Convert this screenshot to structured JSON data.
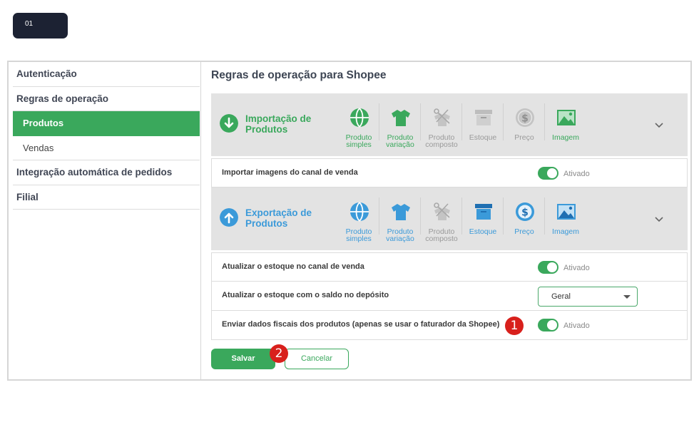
{
  "step_badge": "01",
  "sidebar": {
    "items": [
      {
        "label": "Autenticação"
      },
      {
        "label": "Regras de operação"
      },
      {
        "label": "Produtos"
      },
      {
        "label": "Vendas"
      },
      {
        "label": "Integração automática de pedidos"
      },
      {
        "label": "Filial"
      }
    ],
    "active": "Produtos"
  },
  "main": {
    "title": "Regras de operação para Shopee",
    "import_section": {
      "title": "Importação de Produtos",
      "types": [
        {
          "label": "Produto simples",
          "icon": "ball-icon",
          "enabled": true
        },
        {
          "label": "Produto variação",
          "icon": "shirt-icon",
          "enabled": true
        },
        {
          "label": "Produto composto",
          "icon": "scissors-shirt-icon",
          "enabled": false
        },
        {
          "label": "Estoque",
          "icon": "box-icon",
          "enabled": false
        },
        {
          "label": "Preço",
          "icon": "dollar-icon",
          "enabled": false
        },
        {
          "label": "Imagem",
          "icon": "image-icon",
          "enabled": true
        }
      ],
      "rows": [
        {
          "label": "Importar imagens do canal de venda",
          "toggle": "Ativado"
        }
      ]
    },
    "export_section": {
      "title": "Exportação de Produtos",
      "types": [
        {
          "label": "Produto simples",
          "icon": "ball-icon",
          "enabled": true
        },
        {
          "label": "Produto variação",
          "icon": "shirt-icon",
          "enabled": true
        },
        {
          "label": "Produto composto",
          "icon": "scissors-shirt-icon",
          "enabled": false
        },
        {
          "label": "Estoque",
          "icon": "box-icon",
          "enabled": true
        },
        {
          "label": "Preço",
          "icon": "dollar-icon",
          "enabled": true
        },
        {
          "label": "Imagem",
          "icon": "image-icon",
          "enabled": true
        }
      ],
      "rows": [
        {
          "label": "Atualizar o estoque no canal de venda",
          "toggle": "Ativado"
        },
        {
          "label": "Atualizar o estoque com o saldo no depósito",
          "select_value": "Geral"
        },
        {
          "label": "Enviar dados fiscais dos produtos (apenas se usar o faturador da Shopee)",
          "toggle": "Ativado"
        }
      ]
    },
    "buttons": {
      "save": "Salvar",
      "cancel": "Cancelar"
    },
    "callouts": [
      "1",
      "2"
    ]
  },
  "colors": {
    "green": "#3aa85c",
    "blue": "#3b9ad9",
    "disabled": "#b9b9b9",
    "badge_red": "#d8201c",
    "dark_badge": "#1c2233"
  }
}
